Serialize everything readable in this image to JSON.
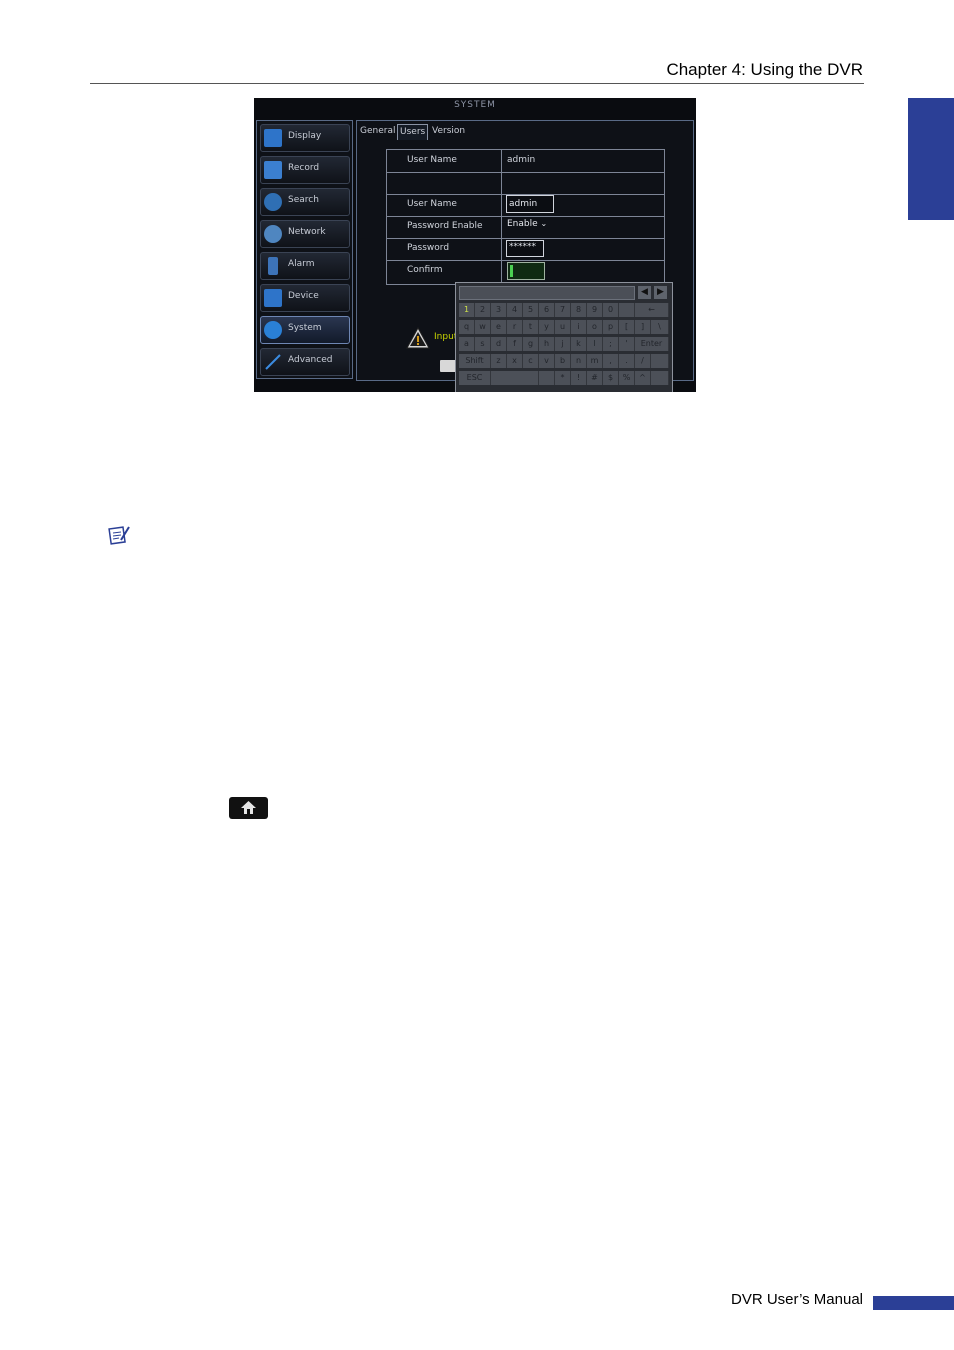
{
  "page": {
    "chapter_title": "Chapter 4: Using the DVR",
    "footer": "DVR User’s Manual",
    "accent_color": "#2b3f96"
  },
  "dvr": {
    "title": "SYSTEM",
    "menu": [
      {
        "label": "Display",
        "icon": "monitor-icon",
        "color": "#2e74c9"
      },
      {
        "label": "Record",
        "icon": "film-icon",
        "color": "#3b7fd0"
      },
      {
        "label": "Search",
        "icon": "magnifier-icon",
        "color": "#2f6fb4"
      },
      {
        "label": "Network",
        "icon": "network-icon",
        "color": "#4f86c0"
      },
      {
        "label": "Alarm",
        "icon": "alarm-icon",
        "color": "#3d73b8"
      },
      {
        "label": "Device",
        "icon": "device-icon",
        "color": "#2e74c9"
      },
      {
        "label": "System",
        "icon": "gear-icon",
        "color": "#2a80d6"
      },
      {
        "label": "Advanced",
        "icon": "wand-icon",
        "color": "#3b8be0"
      }
    ],
    "active_menu": "System",
    "tabs": [
      "General",
      "Users",
      "Version"
    ],
    "active_tab": "Users",
    "rows": [
      {
        "label": "User Name",
        "value": "admin"
      },
      {
        "label": "",
        "value": ""
      },
      {
        "label": "User Name",
        "value": "admin"
      },
      {
        "label": "Password Enable",
        "value": "Enable"
      },
      {
        "label": "Password",
        "value": "******"
      },
      {
        "label": "Confirm",
        "value": ""
      }
    ],
    "warning_text": "Input",
    "keyboard": {
      "row1": [
        "1",
        "2",
        "3",
        "4",
        "5",
        "6",
        "7",
        "8",
        "9",
        "0"
      ],
      "row2": [
        "q",
        "w",
        "e",
        "r",
        "t",
        "y",
        "u",
        "i",
        "o",
        "p",
        "[",
        "]",
        "\\"
      ],
      "row3": [
        "a",
        "s",
        "d",
        "f",
        "g",
        "h",
        "j",
        "k",
        "l",
        ";",
        "'",
        "Enter"
      ],
      "row4": [
        "Shift",
        "z",
        "x",
        "c",
        "v",
        "b",
        "n",
        "m",
        ",",
        ".",
        "/"
      ],
      "row5": [
        "ESC",
        "",
        "*",
        "!",
        "#",
        "$",
        "%",
        "^"
      ]
    }
  }
}
